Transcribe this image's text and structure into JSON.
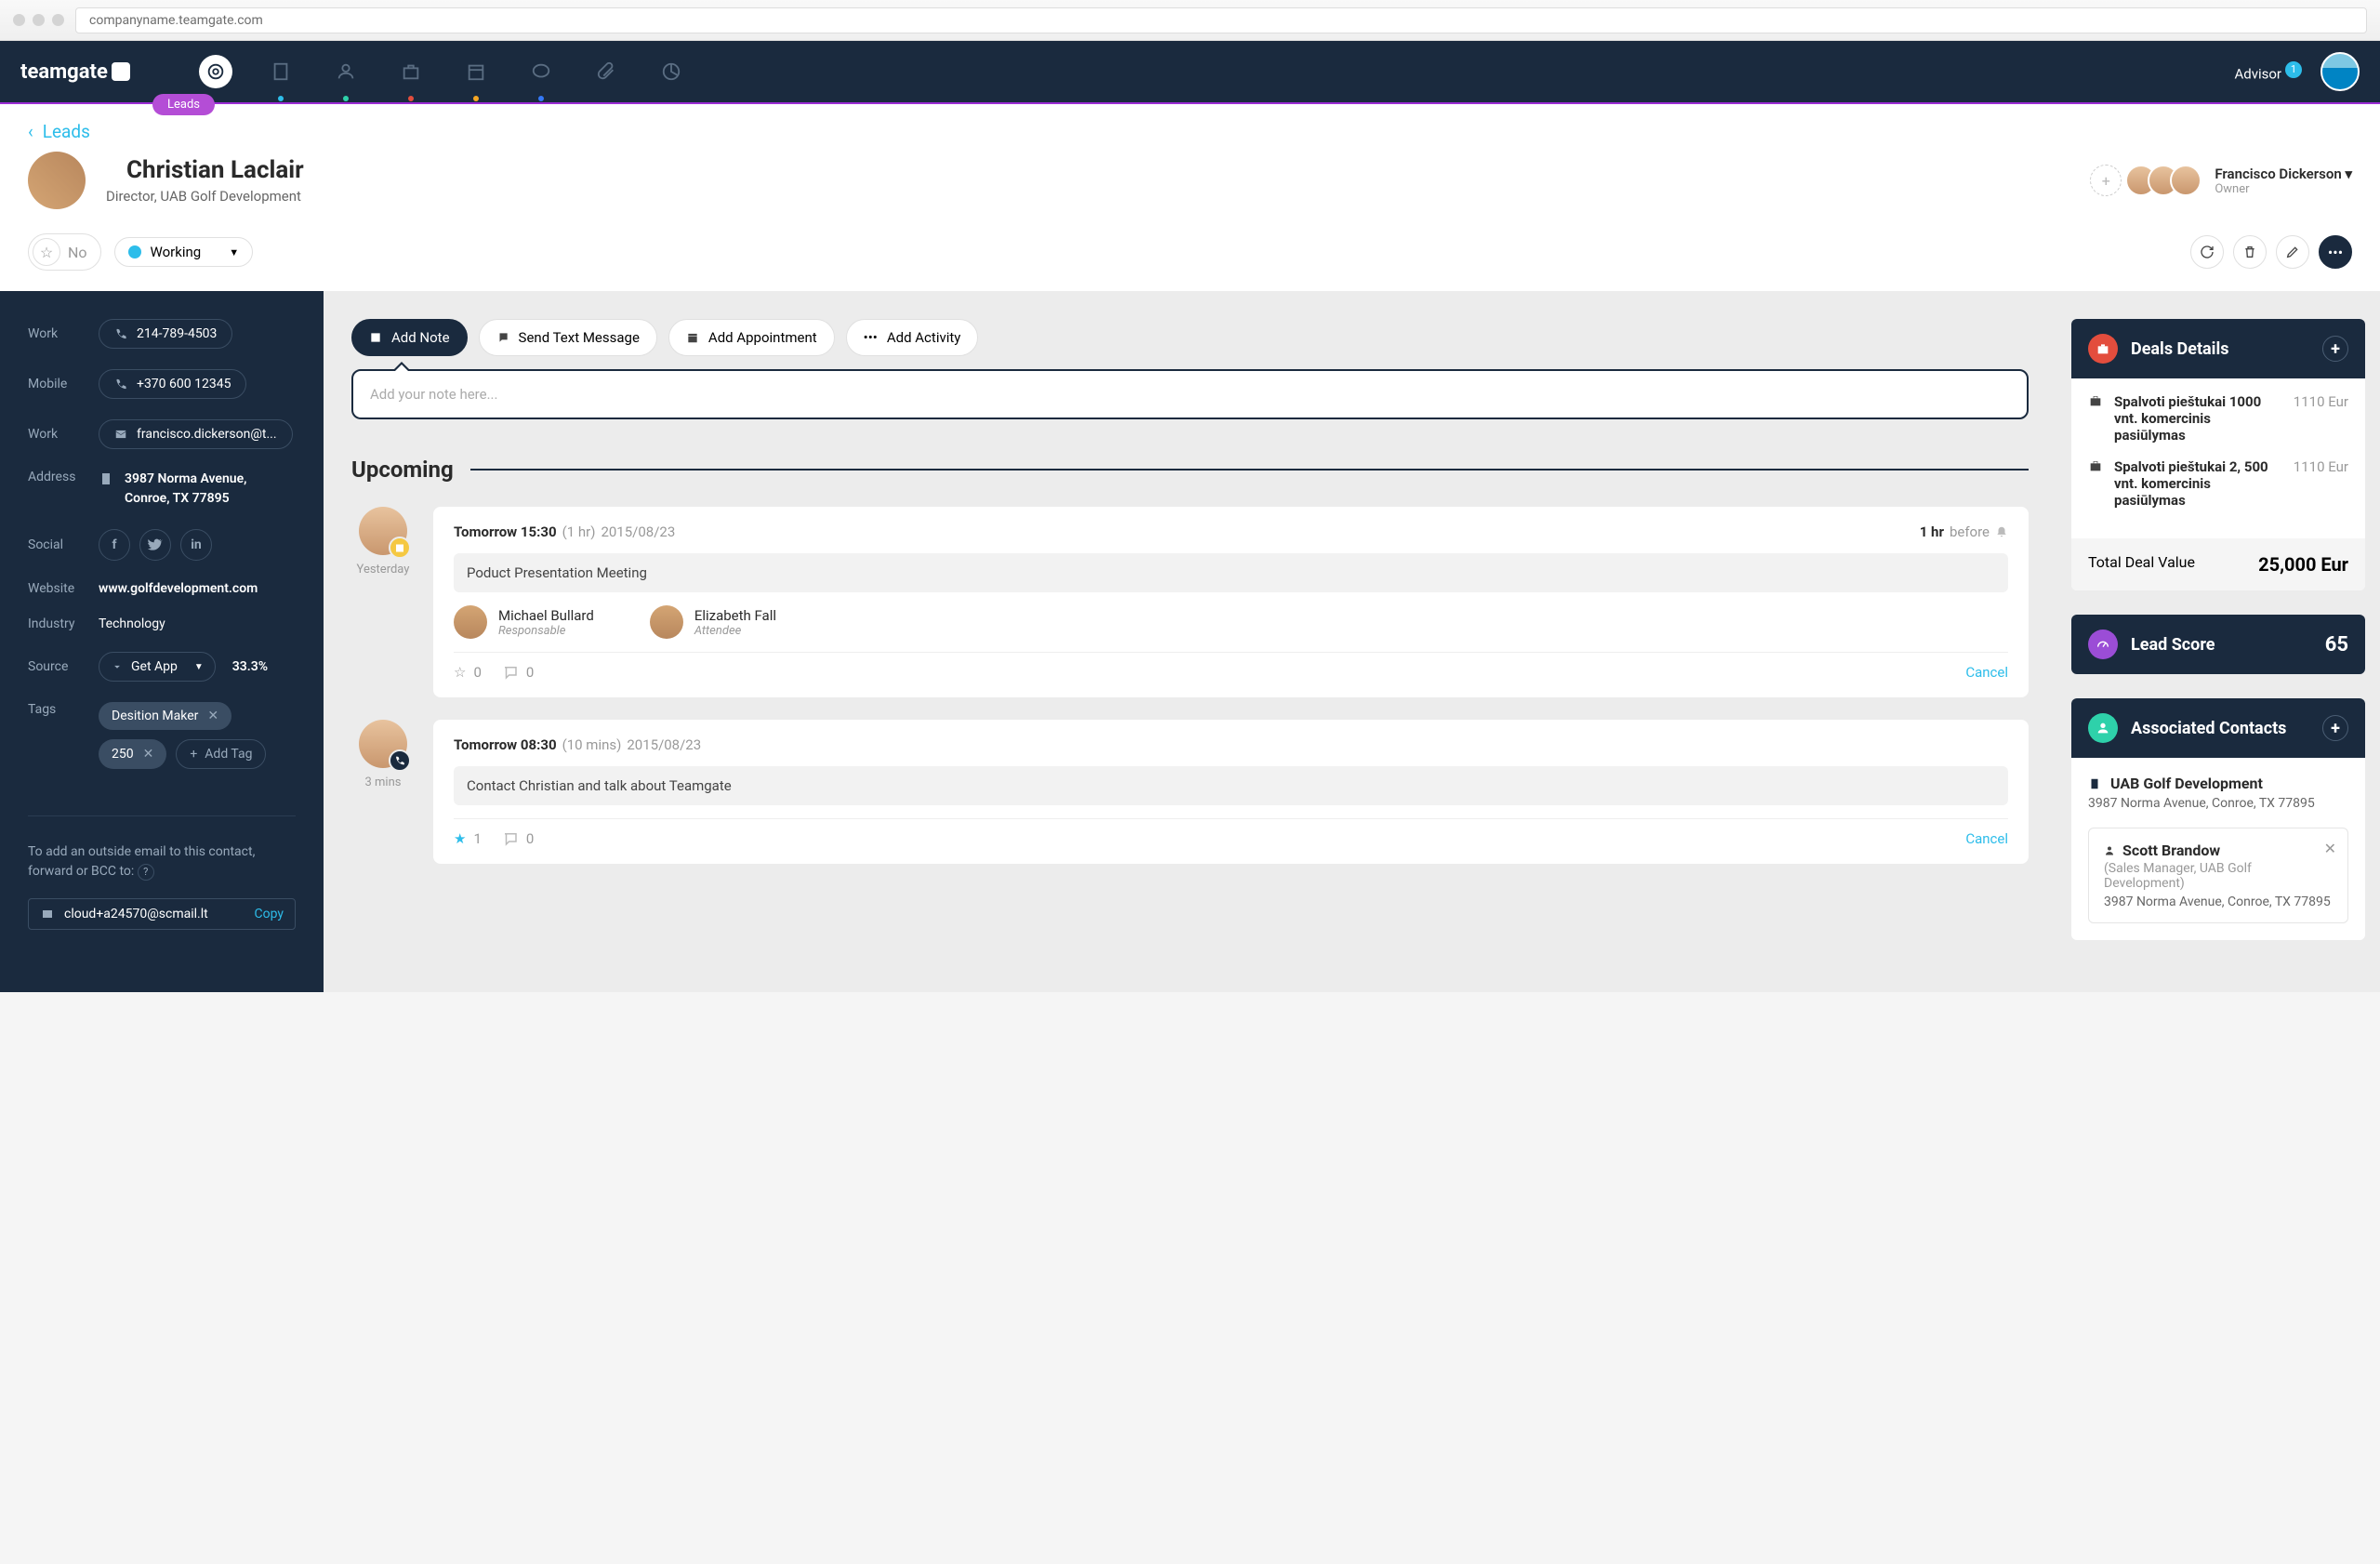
{
  "browser": {
    "url": "companyname.teamgate.com"
  },
  "nav": {
    "logo": "teamgate",
    "advisor_label": "Advisor",
    "advisor_count": "1",
    "leads_pill": "Leads"
  },
  "breadcrumb": {
    "back": "‹",
    "label": "Leads"
  },
  "lead": {
    "name": "Christian Laclair",
    "subtitle": "Director, UAB Golf Development",
    "star_label": "No",
    "status": "Working",
    "owner_name": "Francisco Dickerson",
    "owner_role": "Owner",
    "owner_caret": "▾"
  },
  "sidebar": {
    "work_label": "Work",
    "work_phone": "214-789-4503",
    "mobile_label": "Mobile",
    "mobile_phone": "+370 600 12345",
    "email_label": "Work",
    "email": "francisco.dickerson@t...",
    "address_label": "Address",
    "address1": "3987 Norma Avenue,",
    "address2": "Conroe, TX 77895",
    "social_label": "Social",
    "website_label": "Website",
    "website": "www.golfdevelopment.com",
    "industry_label": "Industry",
    "industry": "Technology",
    "source_label": "Source",
    "source": "Get App",
    "source_pct": "33.3%",
    "tags_label": "Tags",
    "tag1": "Desition Maker",
    "tag2": "250",
    "add_tag": "Add Tag",
    "hint": "To add an outside email to this contact, forward or BCC to:",
    "hint_q": "?",
    "fwd_email": "cloud+a24570@scmail.lt",
    "copy": "Copy"
  },
  "center": {
    "add_note": "Add Note",
    "send_text": "Send Text Message",
    "add_appointment": "Add Appointment",
    "add_activity": "Add Activity",
    "note_placeholder": "Add your note here...",
    "upcoming": "Upcoming",
    "events": {
      "e1": {
        "avatar_time": "Yesterday",
        "time": "Tomorrow 15:30",
        "duration": "(1 hr)",
        "date": "2015/08/23",
        "remind": "1 hr",
        "remind_label": "before",
        "desc": "Poduct Presentation Meeting",
        "p1_name": "Michael Bullard",
        "p1_role": "Responsable",
        "p2_name": "Elizabeth Fall",
        "p2_role": "Attendee",
        "stars": "0",
        "comments": "0",
        "cancel": "Cancel"
      },
      "e2": {
        "avatar_time": "3 mins",
        "time": "Tomorrow 08:30",
        "duration": "(10 mins)",
        "date": "2015/08/23",
        "desc": "Contact Christian and talk about Teamgate",
        "stars": "1",
        "comments": "0",
        "cancel": "Cancel"
      }
    }
  },
  "right": {
    "deals_title": "Deals Details",
    "deal1_name": "Spalvoti pieštukai 1000 vnt. komercinis pasiūlymas",
    "deal1_val": "1110 Eur",
    "deal2_name": "Spalvoti pieštukai 2, 500 vnt. komercinis pasiūlymas",
    "deal2_val": "1110 Eur",
    "total_label": "Total Deal Value",
    "total_val": "25,000 Eur",
    "score_title": "Lead Score",
    "score_val": "65",
    "contacts_title": "Associated Contacts",
    "company": "UAB Golf Development",
    "company_addr": "3987 Norma Avenue, Conroe, TX 77895",
    "contact_name": "Scott Brandow",
    "contact_role": "(Sales Manager, UAB Golf Development)",
    "contact_addr": "3987 Norma Avenue, Conroe, TX 77895"
  }
}
